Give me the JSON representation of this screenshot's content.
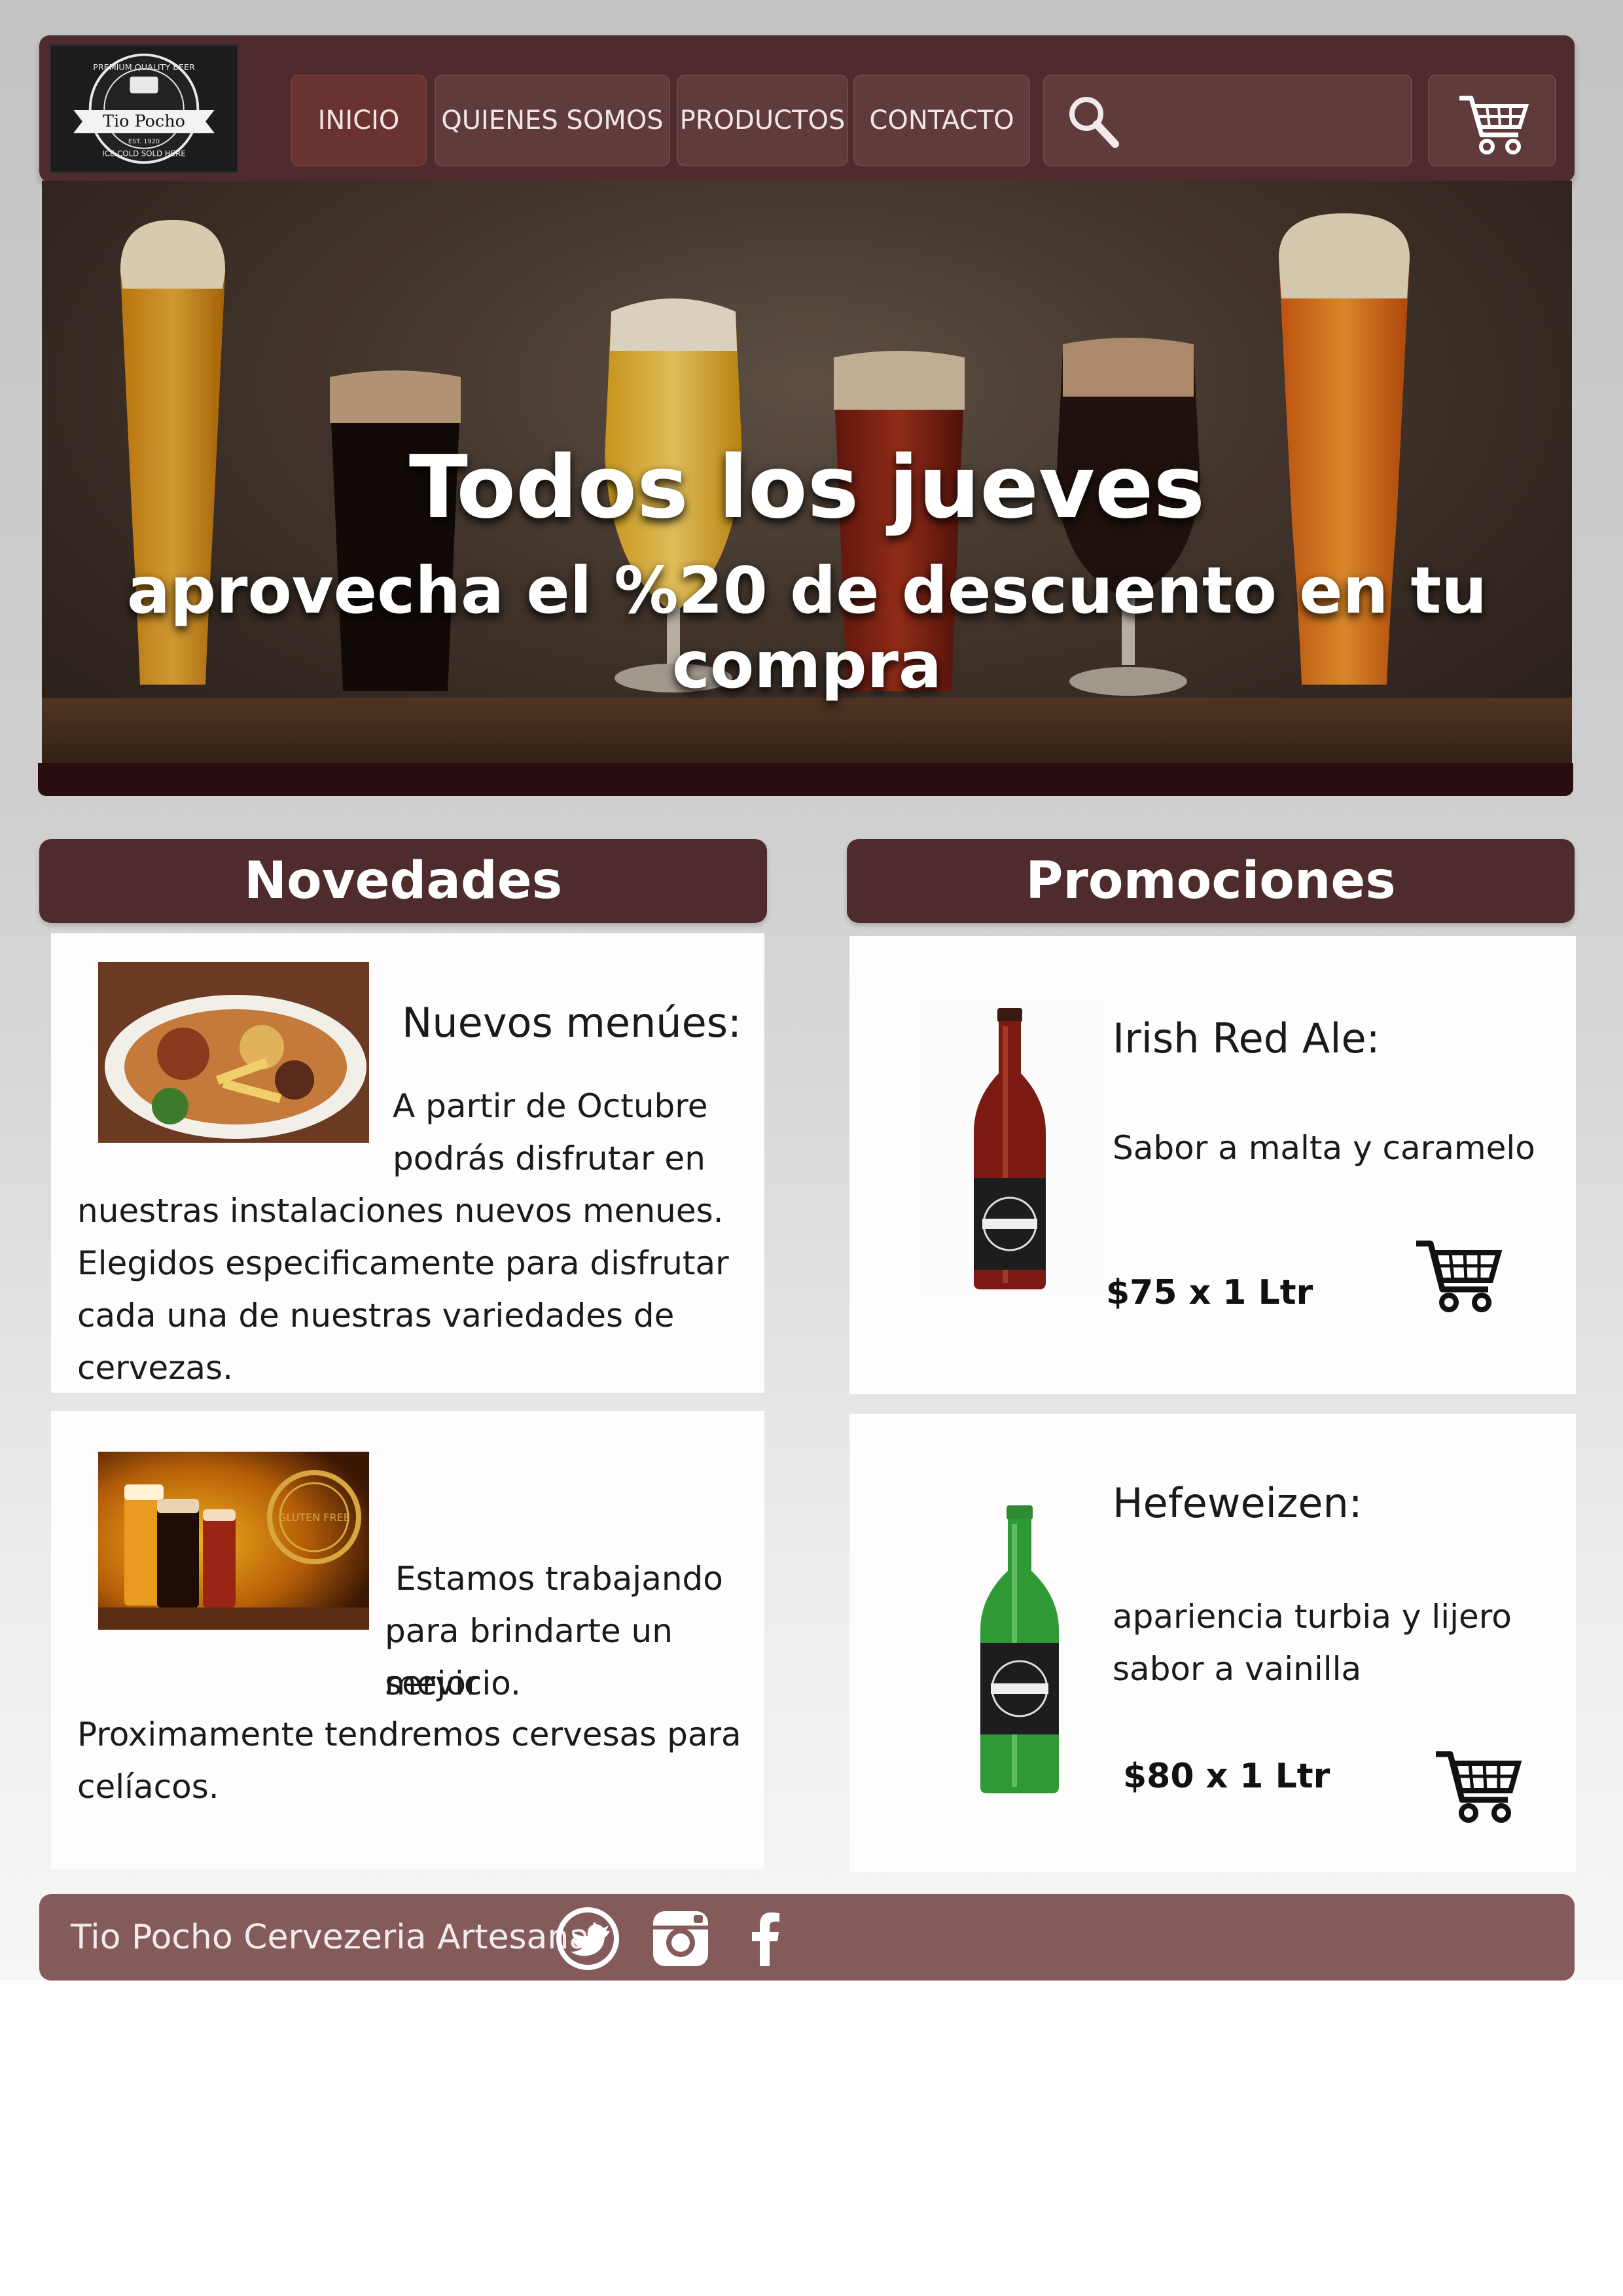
{
  "header": {
    "logo": {
      "brand": "Tio Pocho",
      "ring_text": "PREMIUM QUALITY BEER",
      "bottom_text": "ICE COLD SOLD HERE",
      "badge": "EST. 1920"
    },
    "nav": [
      {
        "label": "INICIO",
        "active": true
      },
      {
        "label": "QUIENES SOMOS",
        "active": false
      },
      {
        "label": "PRODUCTOS",
        "active": false
      },
      {
        "label": "CONTACTO",
        "active": false
      }
    ],
    "search": {
      "icon": "search-icon"
    },
    "cart": {
      "icon": "cart-icon"
    }
  },
  "hero": {
    "title": "Todos los jueves",
    "subtitle": "aprovecha el %20 de descuento en tu compra"
  },
  "novedades": {
    "heading": "Novedades",
    "items": [
      {
        "title": "Nuevos menúes:",
        "lines": [
          "A partir de Octubre",
          "podrás disfrutar en",
          "nuestras instalaciones nuevos menues.",
          "Elegidos especificamente para disfrutar",
          "cada una de nuestras variedades de",
          "cervezas."
        ]
      },
      {
        "title": "",
        "lines": [
          "Estamos trabajando",
          "para brindarte un mejor",
          "servicio.",
          "Proximamente tendremos cervesas para",
          "celíacos."
        ],
        "badge_text": "GLUTEN FREE"
      }
    ]
  },
  "promociones": {
    "heading": "Promociones",
    "items": [
      {
        "name": "Irish Red Ale:",
        "description": "Sabor a malta y caramelo",
        "price": "$75 x 1 Ltr",
        "bottle_color": "#7a1a12"
      },
      {
        "name": "Hefeweizen:",
        "description_lines": [
          "apariencia turbia y lijero",
          "sabor a vainilla"
        ],
        "price": "$80 x 1 Ltr",
        "bottle_color": "#2f9a35"
      }
    ]
  },
  "footer": {
    "text": "Tio Pocho Cervezeria Artesanal",
    "social": [
      "twitter-icon",
      "instagram-icon",
      "facebook-icon"
    ]
  },
  "colors": {
    "primary": "#4e2c2e",
    "footer": "#855a5a",
    "hero_bar": "#2a0d10"
  }
}
